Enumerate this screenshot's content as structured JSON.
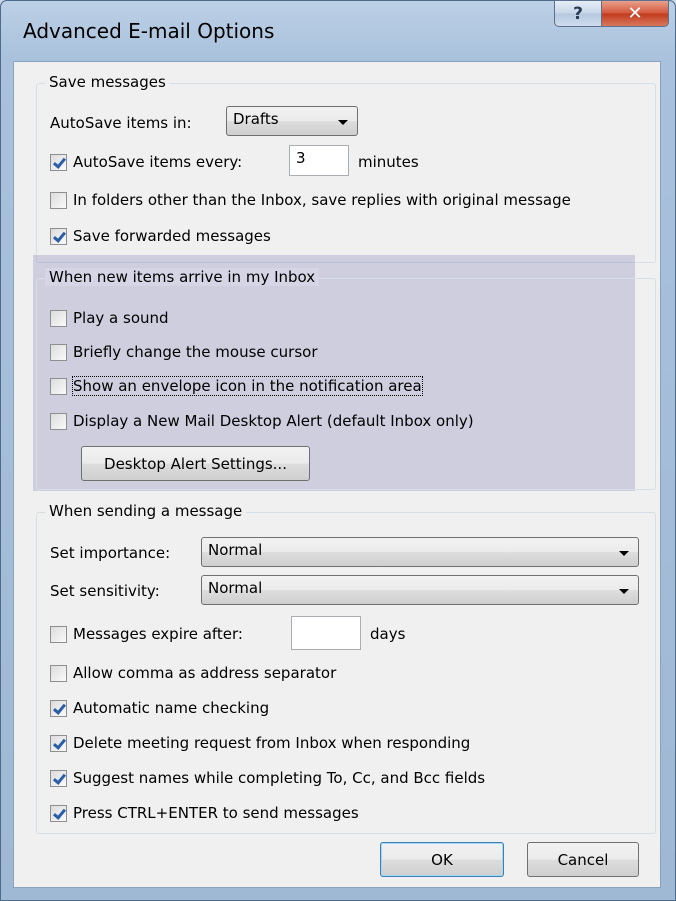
{
  "window": {
    "title": "Advanced E-mail Options",
    "help_glyph": "?",
    "close_glyph": "✕"
  },
  "save_messages": {
    "title": "Save messages",
    "autosave_in_label": "AutoSave items in:",
    "autosave_in_value": "Drafts",
    "autosave_every": {
      "label": "AutoSave items every:",
      "checked": true,
      "value": "3",
      "unit": "minutes"
    },
    "save_replies": {
      "label": "In folders other than the Inbox, save replies with original message",
      "checked": false
    },
    "save_forwarded": {
      "label": "Save forwarded messages",
      "checked": true
    }
  },
  "new_items": {
    "title": "When new items arrive in my Inbox",
    "play_sound": {
      "label": "Play a sound",
      "checked": false
    },
    "change_cursor": {
      "label": "Briefly change the mouse cursor",
      "checked": false
    },
    "envelope_icon": {
      "label": "Show an envelope icon in the notification area",
      "checked": false
    },
    "desktop_alert": {
      "label": "Display a New Mail Desktop Alert (default Inbox only)",
      "checked": false
    },
    "alert_settings_button": "Desktop Alert Settings..."
  },
  "sending": {
    "title": "When sending a message",
    "importance_label": "Set importance:",
    "importance_value": "Normal",
    "sensitivity_label": "Set sensitivity:",
    "sensitivity_value": "Normal",
    "expire": {
      "label": "Messages expire after:",
      "checked": false,
      "value": "",
      "unit": "days"
    },
    "comma_separator": {
      "label": "Allow comma as address separator",
      "checked": false
    },
    "name_checking": {
      "label": "Automatic name checking",
      "checked": true
    },
    "delete_meeting": {
      "label": "Delete meeting request from Inbox when responding",
      "checked": true
    },
    "suggest_names": {
      "label": "Suggest names while completing To, Cc, and Bcc fields",
      "checked": true
    },
    "ctrl_enter": {
      "label": "Press CTRL+ENTER to send messages",
      "checked": true
    }
  },
  "buttons": {
    "ok": "OK",
    "cancel": "Cancel"
  }
}
